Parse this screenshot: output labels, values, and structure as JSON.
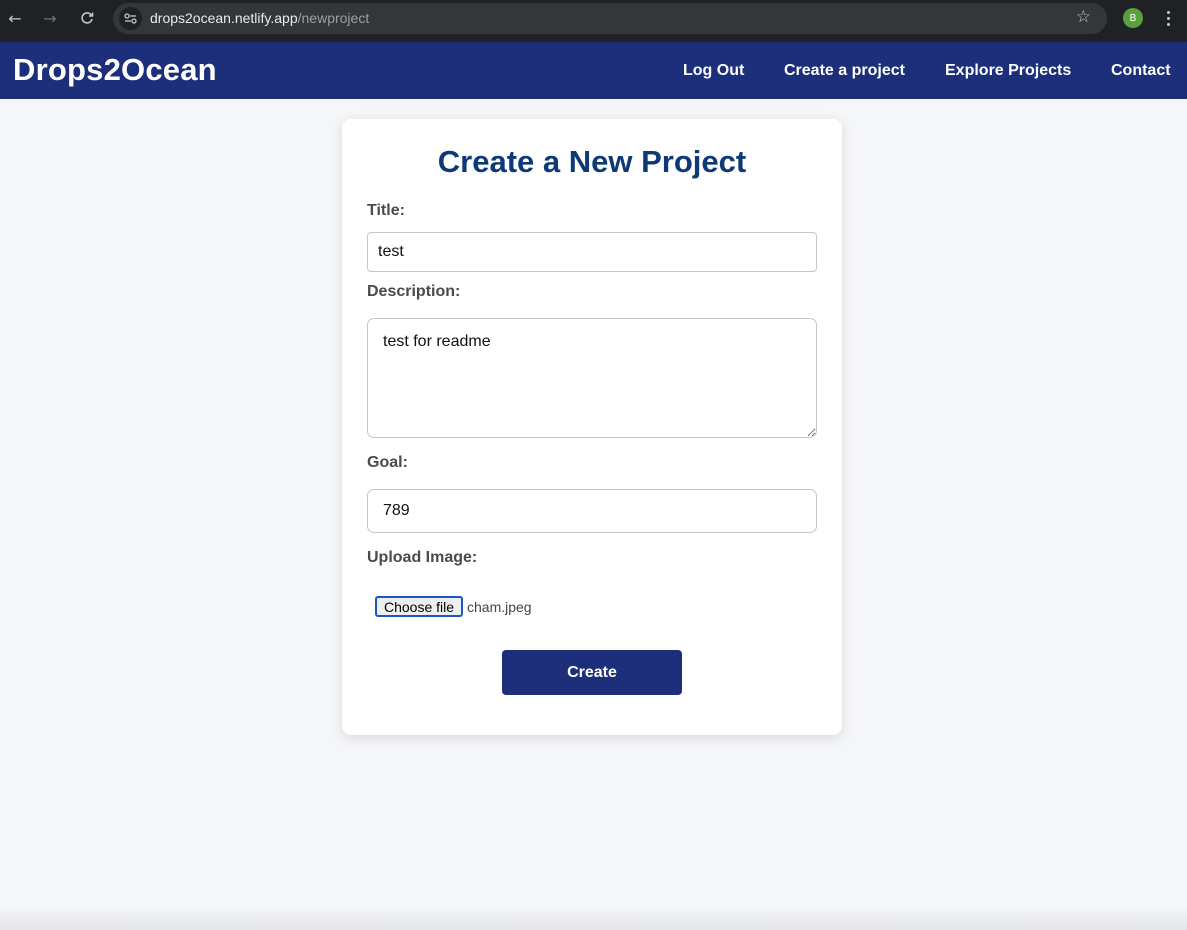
{
  "browser": {
    "url_domain": "drops2ocean.netlify.app",
    "url_path": "/newproject",
    "profile_initial": "B",
    "icons": [
      "back-icon",
      "forward-icon",
      "reload-icon",
      "site-settings-icon",
      "star-icon",
      "menu-icon"
    ]
  },
  "header": {
    "brand": "Drops2Ocean",
    "nav": [
      "Log Out",
      "Create a project",
      "Explore Projects",
      "Contact"
    ],
    "color": "#1d2f7a"
  },
  "form": {
    "heading": "Create a New Project",
    "title_label": "Title:",
    "title_value": "test",
    "description_label": "Description:",
    "description_value": "test for readme",
    "goal_label": "Goal:",
    "goal_value": "789",
    "upload_label": "Upload Image:",
    "choose_file_label": "Choose file",
    "file_name": "cham.jpeg",
    "submit_label": "Create",
    "heading_color": "#0d3a76"
  }
}
